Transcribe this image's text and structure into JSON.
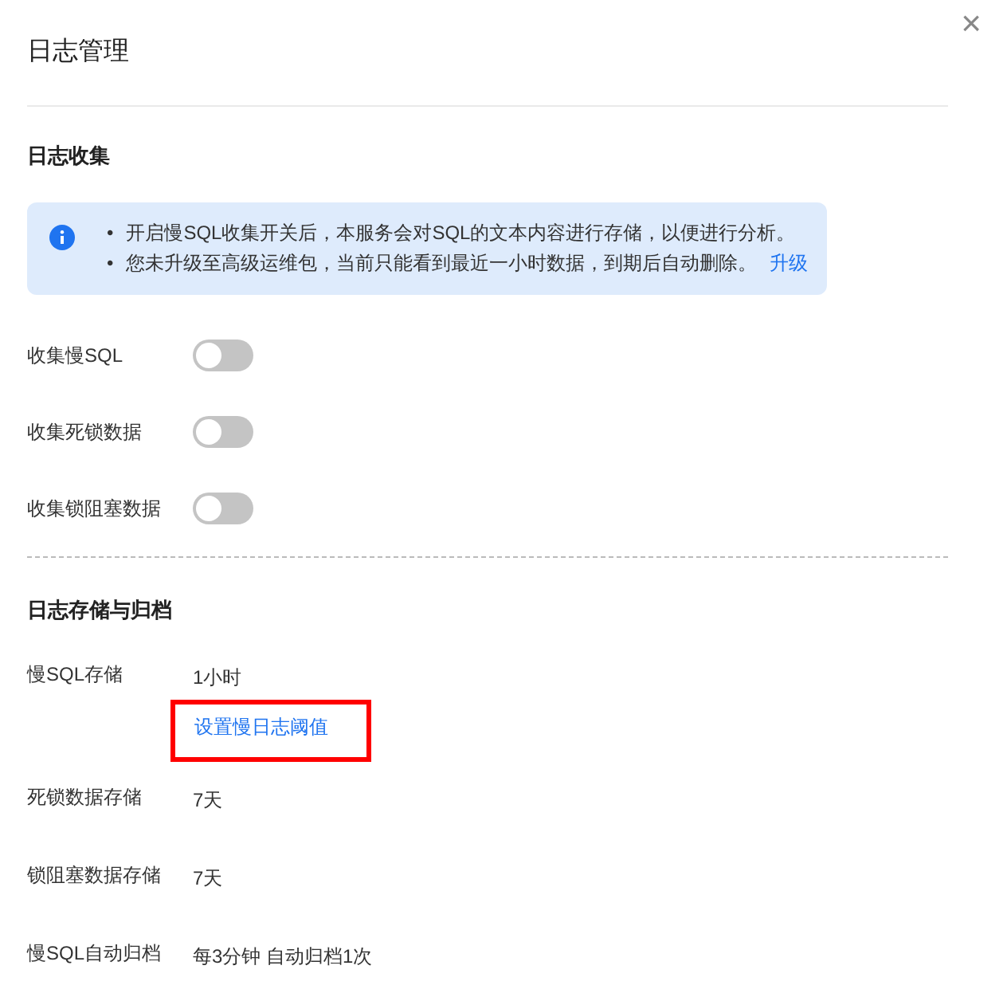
{
  "dialog": {
    "title": "日志管理",
    "close": "×"
  },
  "collection": {
    "title": "日志收集",
    "notice": {
      "bullet": "•",
      "items": [
        "开启慢SQL收集开关后，本服务会对SQL的文本内容进行存储，以便进行分析。",
        "您未升级至高级运维包，当前只能看到最近一小时数据，到期后自动删除。"
      ],
      "link": "升级"
    },
    "switches": [
      {
        "label": "收集慢SQL",
        "on": false
      },
      {
        "label": "收集死锁数据",
        "on": false
      },
      {
        "label": "收集锁阻塞数据",
        "on": false
      }
    ]
  },
  "storage": {
    "title": "日志存储与归档",
    "rows": [
      {
        "label": "慢SQL存储",
        "value": "1小时",
        "link": "设置慢日志阈值",
        "highlighted": true
      },
      {
        "label": "死锁数据存储",
        "value": "7天"
      },
      {
        "label": "锁阻塞数据存储",
        "value": "7天"
      },
      {
        "label": "慢SQL自动归档",
        "value": "每3分钟 自动归档1次"
      }
    ]
  }
}
